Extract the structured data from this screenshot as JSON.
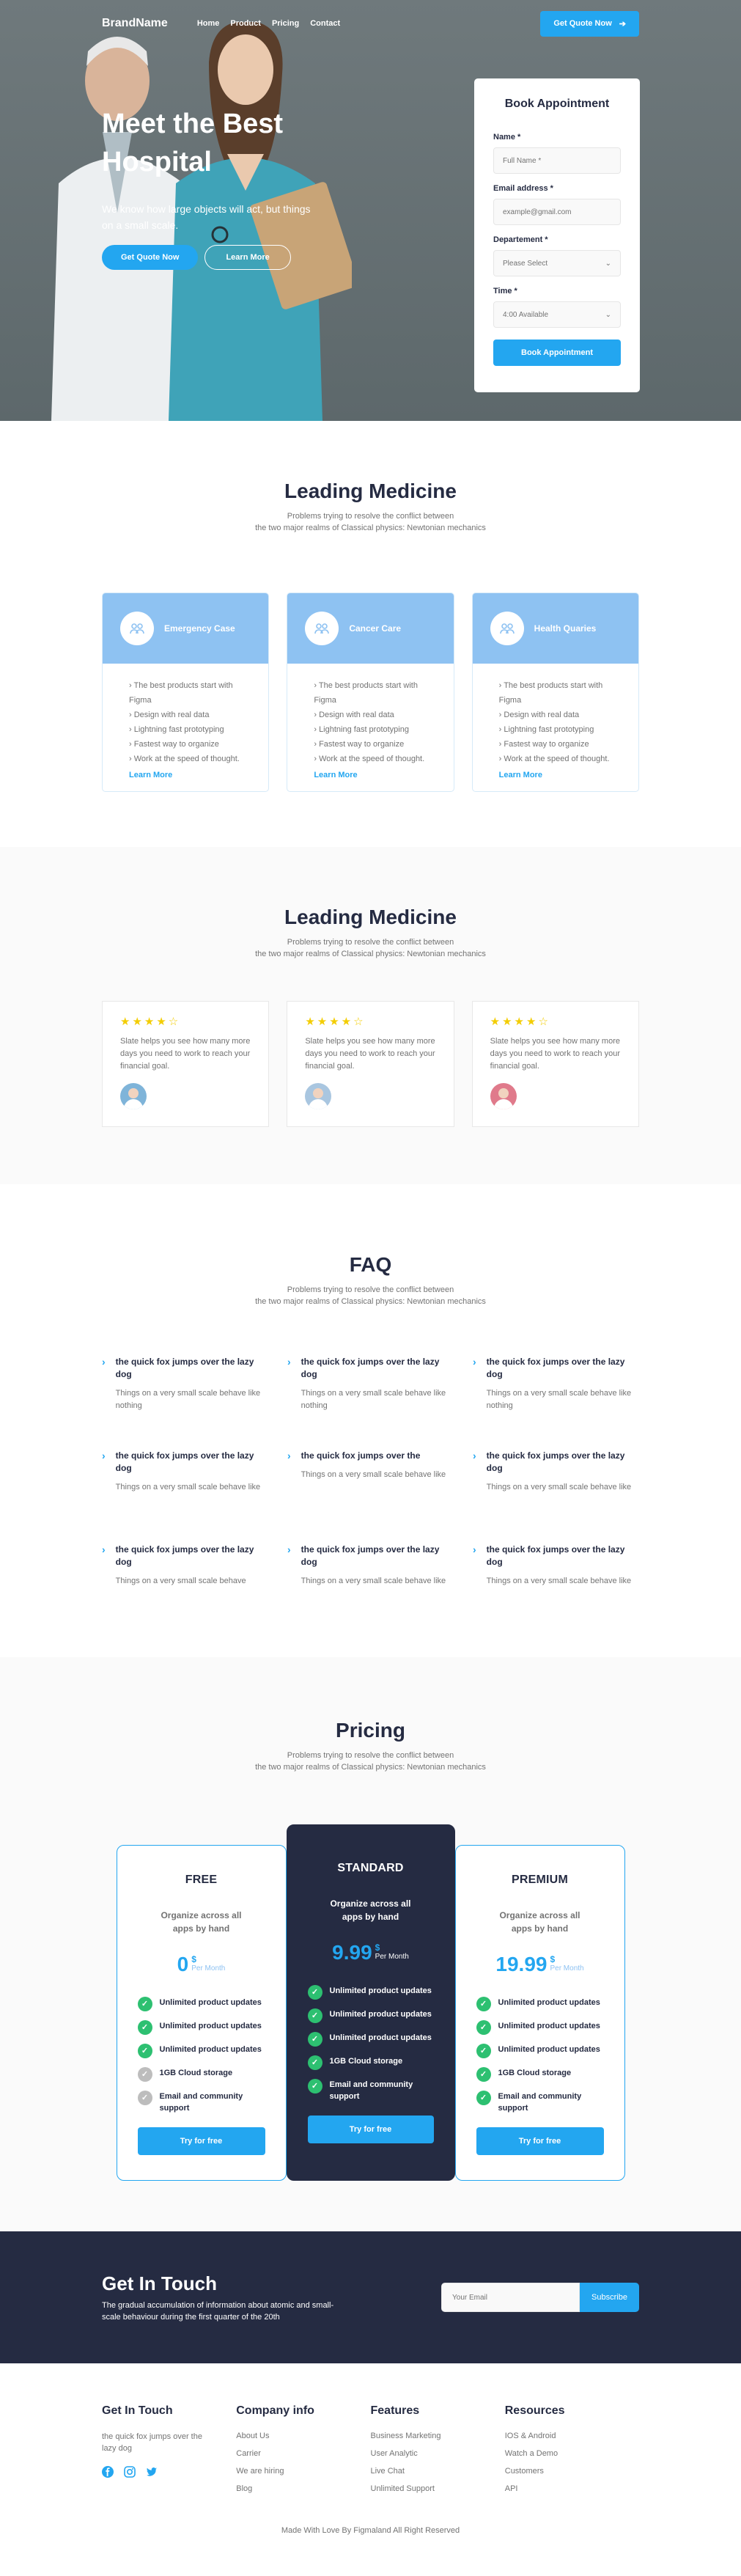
{
  "nav": {
    "brand": "BrandName",
    "links": [
      "Home",
      "Product",
      "Pricing",
      "Contact"
    ],
    "cta": "Get Quote Now"
  },
  "hero": {
    "title": "Meet the Best Hospital",
    "subtitle": "We know how large objects will act, but things on a small scale.",
    "primary_btn": "Get Quote Now",
    "secondary_btn": "Learn More"
  },
  "booking": {
    "title": "Book Appointment",
    "name_label": "Name *",
    "name_placeholder": "Full Name *",
    "email_label": "Email address *",
    "email_placeholder": "example@gmail.com",
    "dept_label": "Departement *",
    "dept_value": "Please Select",
    "time_label": "Time *",
    "time_value": "4:00 Available",
    "submit": "Book Appointment"
  },
  "services": {
    "title": "Leading Medicine",
    "subtitle_line1": "Problems trying to resolve the conflict between",
    "subtitle_line2": "the two major realms of Classical physics: Newtonian mechanics",
    "cards": [
      {
        "name": "Emergency Case",
        "items": [
          "The best products start with Figma",
          "Design with real data",
          "Lightning fast prototyping",
          "Fastest way to organize",
          "Work at the speed of thought."
        ],
        "link": "Learn More"
      },
      {
        "name": "Cancer Care",
        "items": [
          "The best products start with Figma",
          "Design with real data",
          "Lightning fast prototyping",
          "Fastest way to organize",
          "Work at the speed of thought."
        ],
        "link": "Learn More"
      },
      {
        "name": "Health Quaries",
        "items": [
          "The best products start with Figma",
          "Design with real data",
          "Lightning fast prototyping",
          "Fastest way to organize",
          "Work at the speed of thought."
        ],
        "link": "Learn More"
      }
    ]
  },
  "testimonials": {
    "title": "Leading Medicine",
    "subtitle_line1": "Problems trying to resolve the conflict between",
    "subtitle_line2": "the two major realms of Classical physics: Newtonian mechanics",
    "items": [
      {
        "stars": "★★★★☆",
        "text": "Slate helps you see how many more days you need to work to reach your financial goal.",
        "avatar_color": "#7FB4D9"
      },
      {
        "stars": "★★★★☆",
        "text": "Slate helps you see how many more days you need to work to reach your financial goal.",
        "avatar_color": "#A9C6E0"
      },
      {
        "stars": "★★★★☆",
        "text": "Slate helps you see how many more days you need to work to reach your financial goal.",
        "avatar_color": "#E07A8B"
      }
    ]
  },
  "faq": {
    "title": "FAQ",
    "subtitle_line1": "Problems trying to resolve the conflict between",
    "subtitle_line2": "the two major realms of Classical physics: Newtonian mechanics",
    "items": [
      {
        "q": "the quick fox jumps over the lazy dog",
        "a": "Things on a very small scale behave like nothing"
      },
      {
        "q": "the quick fox jumps over the lazy dog",
        "a": "Things on a very small scale behave like nothing"
      },
      {
        "q": "the quick fox jumps over the lazy dog",
        "a": "Things on a very small scale behave like nothing"
      },
      {
        "q": "the quick fox jumps over the lazy dog",
        "a": "Things on a very small scale behave like"
      },
      {
        "q": "the quick fox jumps over the",
        "a": "Things on a very small scale behave like"
      },
      {
        "q": "the quick fox jumps over the lazy dog",
        "a": "Things on a very small scale behave like"
      },
      {
        "q": "the quick fox jumps over the lazy dog",
        "a": "Things on a very small scale behave"
      },
      {
        "q": "the quick fox jumps over the lazy dog",
        "a": "Things on a very small scale behave like"
      },
      {
        "q": "the quick fox jumps over the lazy dog",
        "a": "Things on a very small scale behave like"
      }
    ]
  },
  "pricing": {
    "title": "Pricing",
    "subtitle_line1": "Problems trying to resolve the conflict between",
    "subtitle_line2": "the two major realms of Classical physics: Newtonian mechanics",
    "plans": [
      {
        "name": "FREE",
        "desc": "Organize across all apps by hand",
        "price": "0",
        "currency": "$",
        "per": "Per Month",
        "features": [
          [
            "Unlimited product updates",
            true
          ],
          [
            "Unlimited product updates",
            true
          ],
          [
            "Unlimited product updates",
            true
          ],
          [
            "1GB  Cloud storage",
            false
          ],
          [
            "Email and community support",
            false
          ]
        ],
        "cta": "Try for free"
      },
      {
        "name": "STANDARD",
        "desc": "Organize across all apps by hand",
        "price": "9.99",
        "currency": "$",
        "per": "Per Month",
        "features": [
          [
            "Unlimited product updates",
            true
          ],
          [
            "Unlimited product updates",
            true
          ],
          [
            "Unlimited product updates",
            true
          ],
          [
            "1GB  Cloud storage",
            true
          ],
          [
            "Email and community support",
            true
          ]
        ],
        "cta": "Try for free"
      },
      {
        "name": "PREMIUM",
        "desc": "Organize across all apps by hand",
        "price": "19.99",
        "currency": "$",
        "per": "Per Month",
        "features": [
          [
            "Unlimited product updates",
            true
          ],
          [
            "Unlimited product updates",
            true
          ],
          [
            "Unlimited product updates",
            true
          ],
          [
            "1GB  Cloud storage",
            true
          ],
          [
            "Email and community support",
            true
          ]
        ],
        "cta": "Try for free"
      }
    ]
  },
  "contact": {
    "title": "Get In Touch",
    "desc": "The gradual accumulation of information about atomic and small-scale behaviour during the first quarter of the 20th",
    "email_placeholder": "Your Email",
    "subscribe": "Subscribe"
  },
  "footer": {
    "col1_title": "Get In Touch",
    "col1_desc": "the quick fox jumps over the lazy dog",
    "columns": [
      {
        "title": "Company info",
        "items": [
          "About Us",
          "Carrier",
          "We are hiring",
          "Blog"
        ]
      },
      {
        "title": "Features",
        "items": [
          "Business Marketing",
          "User Analytic",
          "Live Chat",
          "Unlimited Support"
        ]
      },
      {
        "title": "Resources",
        "items": [
          "IOS & Android",
          "Watch a Demo",
          "Customers",
          "API"
        ]
      }
    ],
    "copyright": "Made With Love By Figmaland All Right Reserved"
  },
  "colors": {
    "primary": "#23A6F0",
    "dark": "#252B42",
    "success": "#2DC071",
    "muted": "#737373",
    "card_head": "#8EC2F2",
    "star": "#F3CD03"
  },
  "icons": [
    "arrow-right-icon",
    "chevron-down-icon",
    "team-icon",
    "chevron-right-icon",
    "check-icon",
    "facebook-icon",
    "instagram-icon",
    "twitter-icon"
  ]
}
